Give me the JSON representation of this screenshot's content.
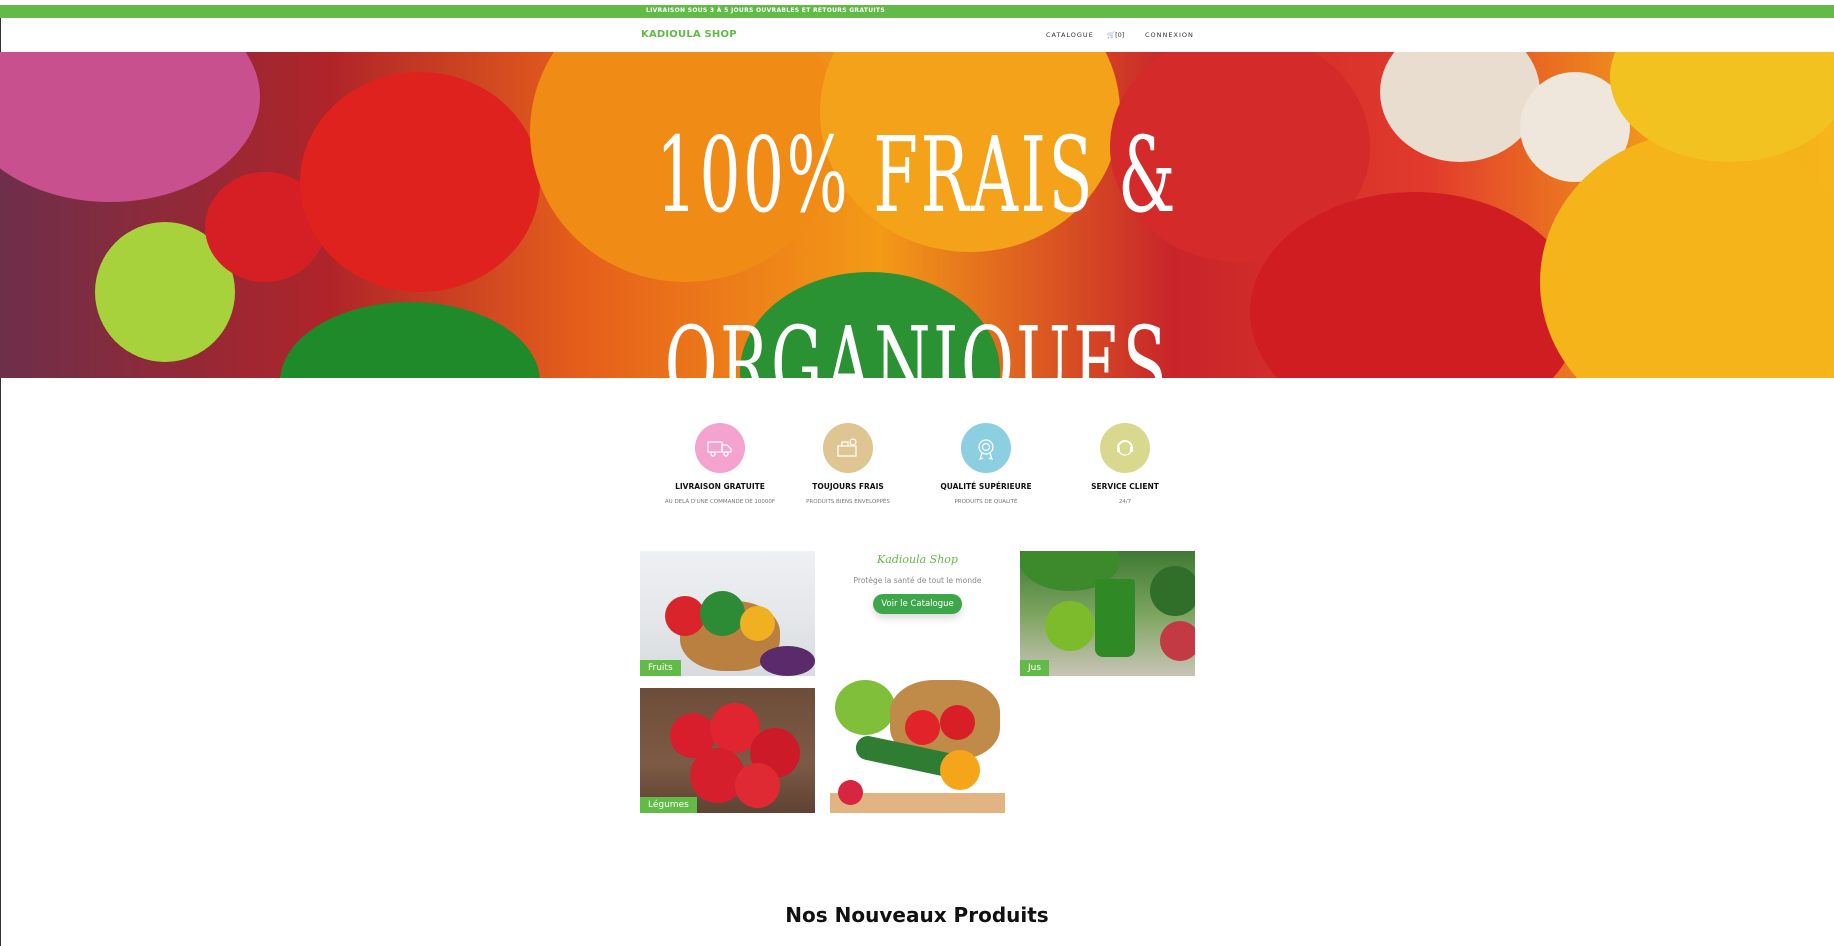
{
  "announcement": "LIVRAISON SOUS 3 À 5 JOURS OUVRABLES ET RETOURS GRATUITS",
  "header": {
    "brand": "KADIOULA SHOP",
    "nav": {
      "catalogue": "CATALOGUE",
      "cart": "[0]",
      "login": "CONNEXION"
    }
  },
  "hero": {
    "line1": "100% FRAIS &",
    "line2": "ORGANIQUES"
  },
  "features": [
    {
      "title": "LIVRAISON GRATUITE",
      "subtitle": "AU DELÀ D'UNE COMMANDE DE 10000F",
      "color": "#f4a3cf",
      "icon": "delivery-truck-icon"
    },
    {
      "title": "TOUJOURS FRAIS",
      "subtitle": "PRODUITS BIENS ENVELOPPÉS",
      "color": "#dec592",
      "icon": "fresh-products-icon"
    },
    {
      "title": "QUALITÉ SUPÉRIEURE",
      "subtitle": "PRODUITS DE QUALITÉ",
      "color": "#8ccfe0",
      "icon": "quality-badge-icon"
    },
    {
      "title": "SERVICE CLIENT",
      "subtitle": "24/7",
      "color": "#d8d88e",
      "icon": "customer-service-icon"
    }
  ],
  "categories": {
    "fruits": "Fruits",
    "jus": "Jus",
    "legumes": "Légumes"
  },
  "promo": {
    "shop_name": "Kadioula Shop",
    "tagline": "Protège la santé de tout le monde",
    "button": "Voir le Catalogue"
  },
  "section_title": "Nos Nouveaux Produits",
  "colors": {
    "brand_green": "#62bb47",
    "button_green": "#3ea64a"
  }
}
